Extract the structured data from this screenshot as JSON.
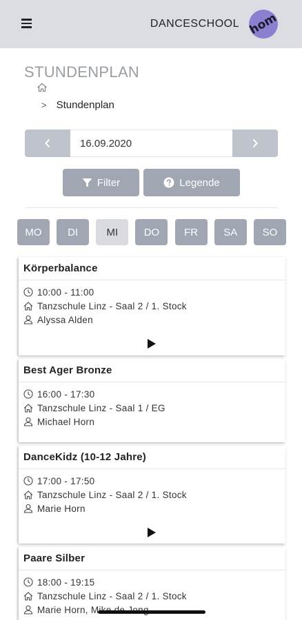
{
  "header": {
    "brand": "DANCESCHOOL",
    "logo_text": "hom"
  },
  "page": {
    "title": "STUNDENPLAN",
    "breadcrumb": "Stundenplan"
  },
  "date_nav": {
    "date": "16.09.2020"
  },
  "actions": {
    "filter_label": "Filter",
    "legend_label": "Legende"
  },
  "days": [
    {
      "label": "MO",
      "active": false
    },
    {
      "label": "DI",
      "active": false
    },
    {
      "label": "MI",
      "active": true
    },
    {
      "label": "DO",
      "active": false
    },
    {
      "label": "FR",
      "active": false
    },
    {
      "label": "SA",
      "active": false
    },
    {
      "label": "SO",
      "active": false
    }
  ],
  "classes": [
    {
      "title": "Körperbalance",
      "time": "10:00 - 11:00",
      "location": "Tanzschule Linz - Saal 2 / 1. Stock",
      "teacher": "Alyssa Alden",
      "has_video": true
    },
    {
      "title": "Best Ager Bronze",
      "time": "16:00 - 17:30",
      "location": "Tanzschule Linz - Saal 1 / EG",
      "teacher": "Michael Horn",
      "has_video": false
    },
    {
      "title": "DanceKidz (10-12 Jahre)",
      "time": "17:00 - 17:50",
      "location": "Tanzschule Linz - Saal 2 / 1. Stock",
      "teacher": "Marie Horn",
      "has_video": true
    },
    {
      "title": "Paare Silber",
      "time": "18:00 - 19:15",
      "location": "Tanzschule Linz - Saal 2 / 1. Stock",
      "teacher": "Marie Horn, Mike de Jong",
      "has_video": false
    }
  ]
}
